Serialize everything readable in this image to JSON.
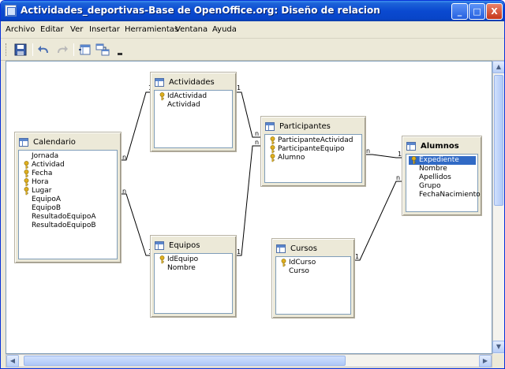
{
  "window": {
    "title": "Actividades_deportivas-Base de OpenOffice.org: Diseño de relacion",
    "controls": {
      "minimize": "_",
      "maximize": "□",
      "close": "X"
    }
  },
  "menubar": {
    "items": [
      "Archivo",
      "Editar",
      "Ver",
      "Insertar",
      "Herramientas",
      "Ventana",
      "Ayuda"
    ]
  },
  "toolbar": {
    "icons": [
      "save-icon",
      "undo-icon",
      "redo-icon",
      "new-relation-icon",
      "add-tables-icon",
      "toolbar-options-icon"
    ]
  },
  "tables": {
    "actividades": {
      "title": "Actividades",
      "fields": [
        {
          "name": "IdActividad",
          "key": true
        },
        {
          "name": "Actividad",
          "key": false
        }
      ]
    },
    "calendario": {
      "title": "Calendario",
      "fields": [
        {
          "name": "Jornada",
          "key": false
        },
        {
          "name": "Actividad",
          "key": true
        },
        {
          "name": "Fecha",
          "key": true
        },
        {
          "name": "Hora",
          "key": true
        },
        {
          "name": "Lugar",
          "key": true
        },
        {
          "name": "EquipoA",
          "key": false
        },
        {
          "name": "EquipoB",
          "key": false
        },
        {
          "name": "ResultadoEquipoA",
          "key": false
        },
        {
          "name": "ResultadoEquipoB",
          "key": false
        }
      ]
    },
    "participantes": {
      "title": "Participantes",
      "fields": [
        {
          "name": "ParticipanteActividad",
          "key": true
        },
        {
          "name": "ParticipanteEquipo",
          "key": true
        },
        {
          "name": "Alumno",
          "key": true
        }
      ]
    },
    "alumnos": {
      "title": "Alumnos",
      "fields": [
        {
          "name": "Expediente",
          "key": true,
          "selected": true
        },
        {
          "name": "Nombre",
          "key": false
        },
        {
          "name": "Apellidos",
          "key": false
        },
        {
          "name": "Grupo",
          "key": false
        },
        {
          "name": "FechaNacimiento",
          "key": false
        }
      ]
    },
    "equipos": {
      "title": "Equipos",
      "fields": [
        {
          "name": "IdEquipo",
          "key": true
        },
        {
          "name": "Nombre",
          "key": false
        }
      ]
    },
    "cursos": {
      "title": "Cursos",
      "fields": [
        {
          "name": "IdCurso",
          "key": true
        },
        {
          "name": "Curso",
          "key": false
        }
      ]
    }
  },
  "relations": {
    "one": "1",
    "many": "n"
  },
  "colors": {
    "titlebar": "#0a49d0",
    "selection": "#316ac5",
    "canvas": "#ffffff",
    "key": "#e0b020"
  }
}
